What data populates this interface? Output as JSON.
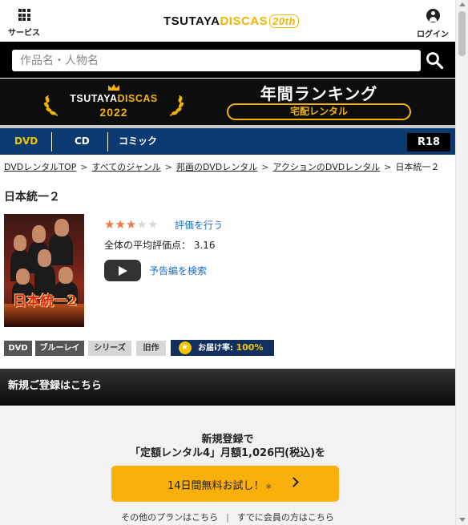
{
  "header": {
    "services_label": "サービス",
    "logo_part1": "TSUTAYA",
    "logo_part2": "DISCAS",
    "logo_anniversary": "20th",
    "login_label": "ログイン"
  },
  "search": {
    "placeholder": "作品名・人物名",
    "value": ""
  },
  "banner": {
    "logo_part1": "TSUTAYA",
    "logo_part2": "DISCAS",
    "year": "2022",
    "title": "年間ランキング",
    "subtitle": "宅配レンタル"
  },
  "nav": {
    "tabs": [
      {
        "label": "DVD",
        "active": true
      },
      {
        "label": "CD",
        "active": false
      },
      {
        "label": "コミック",
        "active": false
      }
    ],
    "r18_label": "R18"
  },
  "breadcrumb": {
    "items": [
      "DVDレンタルTOP",
      "すべてのジャンル",
      "邦画のDVDレンタル",
      "アクションのDVDレンタル"
    ],
    "current": "日本統一２",
    "separator": ">"
  },
  "product": {
    "title": "日本統一２",
    "cover_title": "日本統一2",
    "rating_stars": 3,
    "rating_max": 5,
    "rate_link": "評価を行う",
    "avg_label": "全体の平均評価点：",
    "avg_value": "3.16",
    "trailer_link": "予告編を検索",
    "tags": [
      "DVD",
      "ブルーレイ",
      "シリーズ",
      "旧作"
    ],
    "delivery_label": "お届け率:",
    "delivery_rate": "100%"
  },
  "register": {
    "header": "新規ご登録はこちら",
    "line1": "新規登録で",
    "line2": "「定額レンタル4」月額1,026円(税込)を",
    "cta_label": "14日間無料お試し！",
    "cta_note": "※",
    "link_other_plans": "その他のプランはこちら",
    "link_members": "すでに会員の方はこちら"
  },
  "colors": {
    "brand_yellow": "#f3b400",
    "nav_blue": "#0b3a72",
    "link_blue": "#1d6fc4",
    "cta_orange": "#fab00a"
  }
}
